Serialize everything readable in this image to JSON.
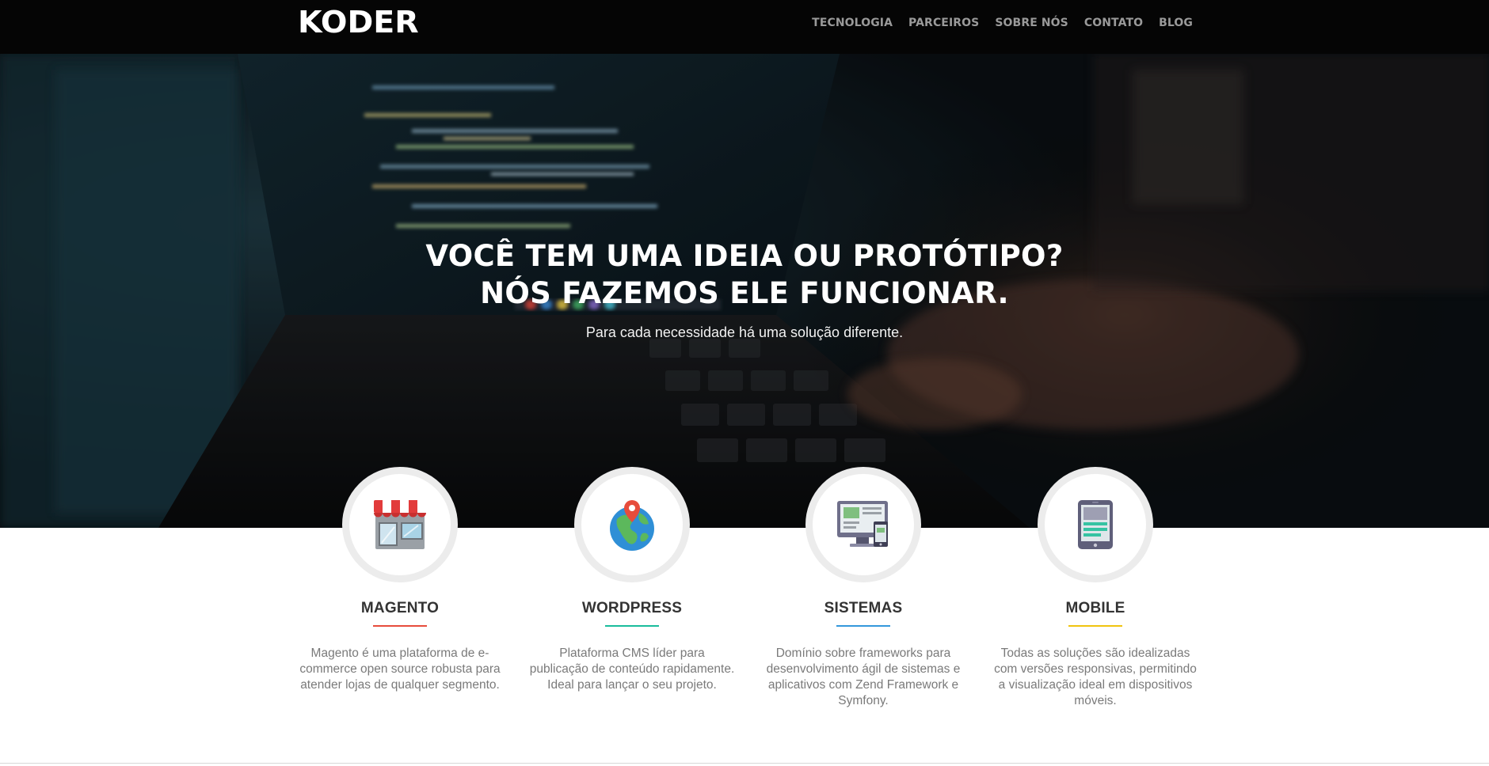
{
  "brand": {
    "logo": "KODER"
  },
  "nav": {
    "items": [
      {
        "label": "TECNOLOGIA"
      },
      {
        "label": "PARCEIROS"
      },
      {
        "label": "SOBRE NÓS"
      },
      {
        "label": "CONTATO"
      },
      {
        "label": "BLOG"
      }
    ]
  },
  "hero": {
    "title_line1": "VOCÊ TEM UMA IDEIA OU PROTÓTIPO?",
    "title_line2": "NÓS FAZEMOS ELE FUNCIONAR.",
    "subtitle": "Para cada necessidade há uma solução diferente."
  },
  "features": [
    {
      "icon": "storefront-icon",
      "title": "MAGENTO",
      "accent": "#e74c3c",
      "description": "Magento é uma plataforma de e-commerce open source robusta para atender lojas de qualquer segmento."
    },
    {
      "icon": "globe-pin-icon",
      "title": "WORDPRESS",
      "accent": "#1abc9c",
      "description": "Plataforma CMS líder para publicação de conteúdo rapidamente. Ideal para lançar o seu projeto."
    },
    {
      "icon": "devices-icon",
      "title": "SISTEMAS",
      "accent": "#3498db",
      "description": "Domínio sobre frameworks para desenvolvimento ágil de sistemas e aplicativos com Zend Framework e Symfony."
    },
    {
      "icon": "tablet-icon",
      "title": "MOBILE",
      "accent": "#f1c40f",
      "description": "Todas as soluções são idealizadas com versões responsivas, permitindo a visualização ideal em dispositivos móveis."
    }
  ]
}
